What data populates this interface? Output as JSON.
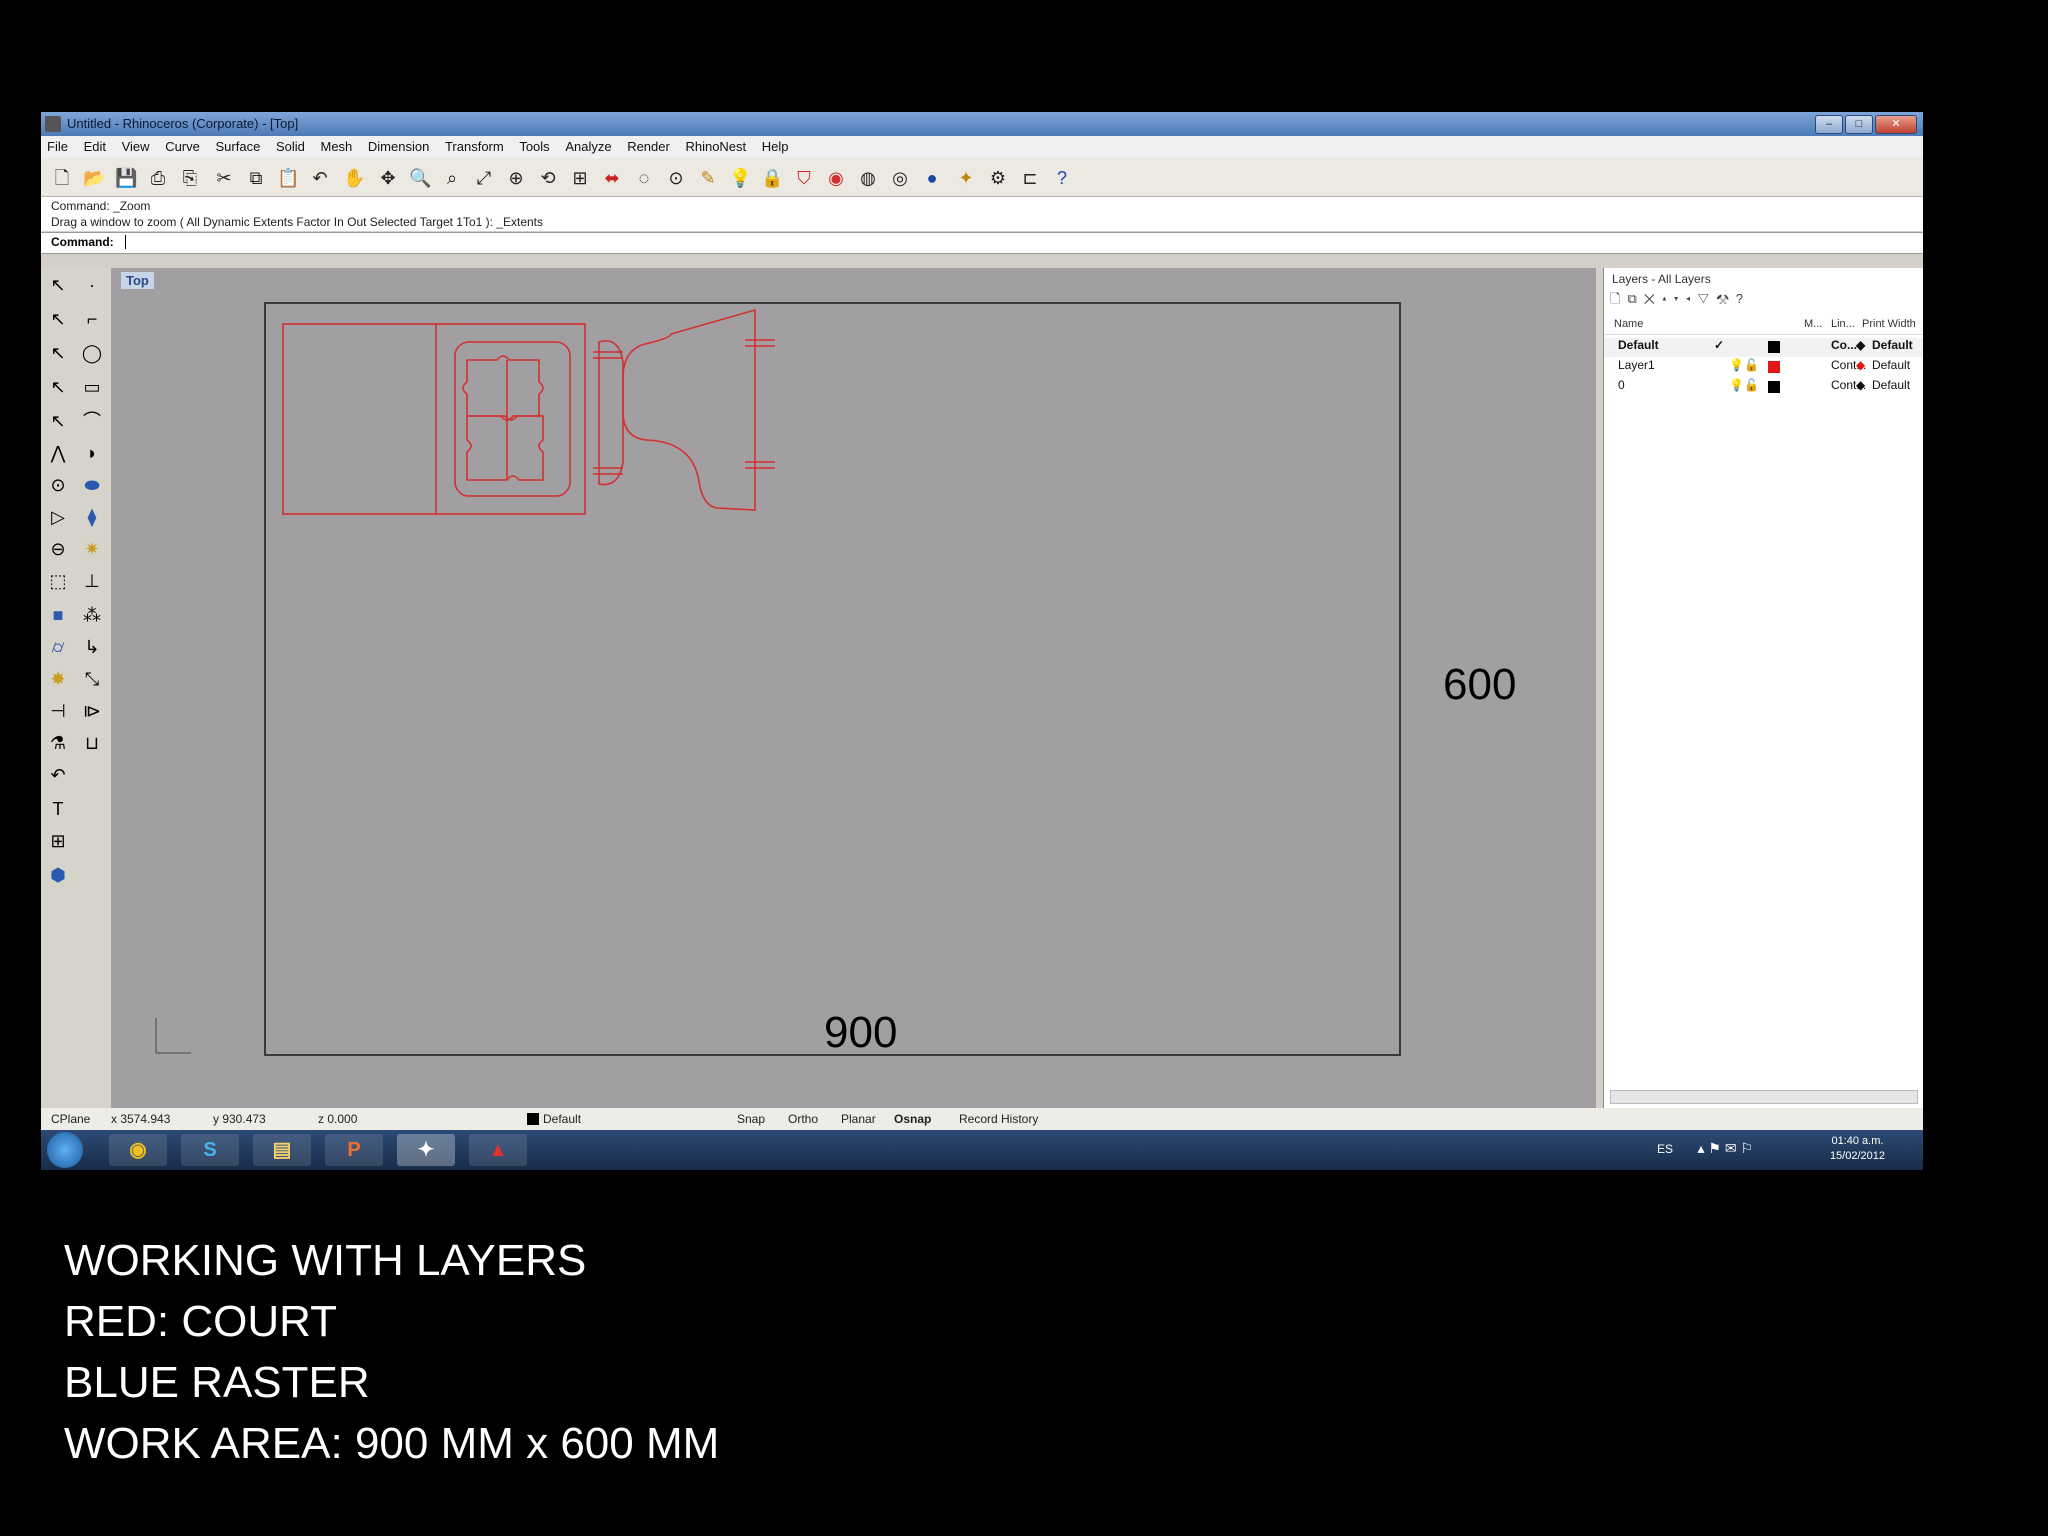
{
  "window": {
    "title": "Untitled - Rhinoceros (Corporate) - [Top]",
    "controls": [
      "–",
      "□",
      "✕"
    ]
  },
  "menu": [
    "File",
    "Edit",
    "View",
    "Curve",
    "Surface",
    "Solid",
    "Mesh",
    "Dimension",
    "Transform",
    "Tools",
    "Analyze",
    "Render",
    "RhinoNest",
    "Help"
  ],
  "command": {
    "history_1": "Command: _Zoom",
    "history_2": "Drag a window to zoom ( All  Dynamic  Extents  Factor  In  Out  Selected  Target  1To1 ): _Extents",
    "prompt": "Command:"
  },
  "viewport": {
    "label": "Top",
    "dim_width": "900",
    "dim_height": "600",
    "work_area_stroke": "#3a3a3a",
    "court_color": "#d33030"
  },
  "layers": {
    "title": "Layers - All Layers",
    "toolbar_icons": [
      "new-layer",
      "new-sublayer",
      "delete",
      "up",
      "down",
      "left",
      "filter",
      "tools",
      "help"
    ],
    "headers": {
      "name": "Name",
      "material": "M...",
      "linetype": "Lin...",
      "print_width": "Print Width"
    },
    "rows": [
      {
        "name": "Default",
        "current": "✓",
        "color": "#000000",
        "linetype": "Co...",
        "print_width": "Default"
      },
      {
        "name": "Layer1",
        "current": "",
        "color": "#e01818",
        "linetype": "Cont...",
        "print_width": "Default"
      },
      {
        "name": "0",
        "current": "",
        "color": "#000000",
        "linetype": "Cont...",
        "print_width": "Default"
      }
    ]
  },
  "status": {
    "cplane": "CPlane",
    "x": "x 3574.943",
    "y": "y 930.473",
    "z": "z 0.000",
    "layer": "Default",
    "snap": "Snap",
    "ortho": "Ortho",
    "planar": "Planar",
    "osnap": "Osnap",
    "record_history": "Record History"
  },
  "taskbar": {
    "lang": "ES",
    "time": "01:40 a.m.",
    "date": "15/02/2012"
  },
  "caption": {
    "line1": "WORKING WITH LAYERS",
    "line2": "RED: COURT",
    "line3": "BLUE RASTER",
    "line4": "WORK AREA: 900 MM x 600 MM"
  }
}
